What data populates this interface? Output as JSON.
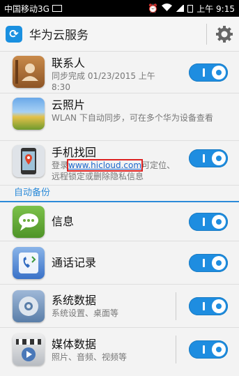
{
  "status_bar": {
    "carrier": "中国移动3G",
    "network": "3G",
    "time": "上午 9:15"
  },
  "app": {
    "title": "华为云服务"
  },
  "sync_items": [
    {
      "title": "联系人",
      "sub": "同步完成 01/23/2015 上午 8:30",
      "enabled": true
    },
    {
      "title": "云照片",
      "sub": "WLAN 下自动同步，可在多个华为设备查看",
      "enabled": null
    },
    {
      "title": "手机找回",
      "sub_before": "登录",
      "link": "www.hicloud.com",
      "sub_after": "可定位、远程锁定或删除隐私信息",
      "enabled": true
    }
  ],
  "backup_section": {
    "label": "自动备份"
  },
  "backup_items": [
    {
      "title": "信息",
      "sub": "",
      "enabled": true
    },
    {
      "title": "通话记录",
      "sub": "",
      "enabled": true
    },
    {
      "title": "系统数据",
      "sub": "系统设置、桌面等",
      "enabled": true
    },
    {
      "title": "媒体数据",
      "sub": "照片、音频、视频等",
      "enabled": true
    }
  ],
  "colors": {
    "accent": "#1e8de0",
    "highlight_box": "#dd2222"
  }
}
